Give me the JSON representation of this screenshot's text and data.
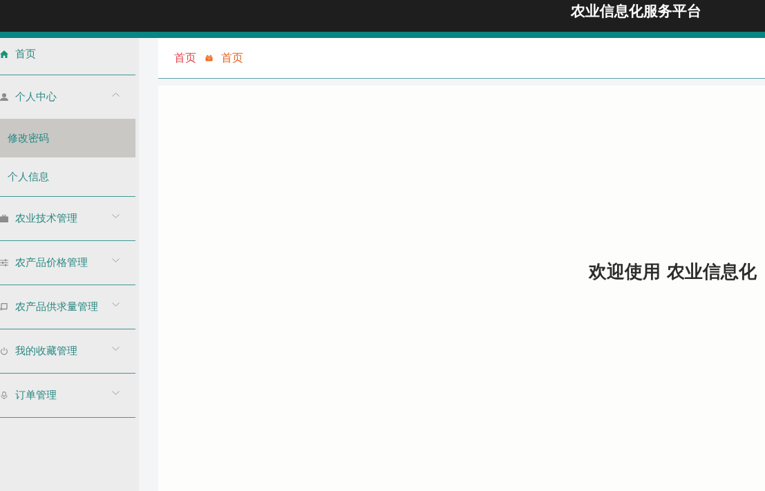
{
  "header": {
    "title": "农业信息化服务平台"
  },
  "sidebar": {
    "items": [
      {
        "label": "首页",
        "kind": "link",
        "selected": false
      },
      {
        "label": "个人中心",
        "kind": "group",
        "selected": false,
        "expanded": true,
        "children": [
          {
            "label": "修改密码",
            "selected": true
          },
          {
            "label": "个人信息",
            "selected": false
          }
        ]
      },
      {
        "label": "农业技术管理",
        "kind": "group",
        "selected": false,
        "expanded": false
      },
      {
        "label": "农产品价格管理",
        "kind": "group",
        "selected": false,
        "expanded": false
      },
      {
        "label": "农产品供求量管理",
        "kind": "group",
        "selected": false,
        "expanded": false
      },
      {
        "label": "我的收藏管理",
        "kind": "group",
        "selected": false,
        "expanded": false
      },
      {
        "label": "订单管理",
        "kind": "group",
        "selected": false,
        "expanded": false
      }
    ]
  },
  "breadcrumb": [
    {
      "label": "首页",
      "kind": "link"
    },
    {
      "label": "首页",
      "kind": "current"
    }
  ],
  "welcome": {
    "text": "欢迎使用 农业信息化"
  }
}
